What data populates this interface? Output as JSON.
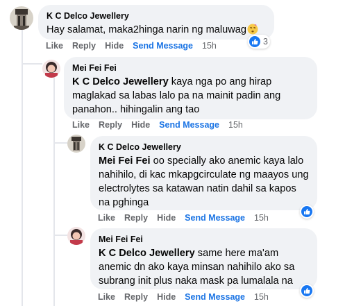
{
  "comments": [
    {
      "author": "K C Delco Jewellery",
      "mention": "",
      "text": "Hay salamat, maka2hinga narin ng maluwag",
      "emoji_icon": "face-with-spiral-eyes-icon",
      "time": "15h",
      "reaction_count": "3"
    },
    {
      "author": "Mei Fei Fei",
      "mention": "K C Delco Jewellery",
      "text": " kaya nga po ang hirap maglakad sa labas lalo pa na mainit padin ang panahon.. hihingalin ang tao",
      "time": "15h"
    },
    {
      "author": "K C Delco Jewellery",
      "mention": "Mei Fei Fei",
      "text": " oo specially ako anemic kaya lalo nahihilo, di kac mkapgcirculate ng maayos ung electrolytes sa katawan natin dahil sa kapos na pghinga",
      "time": "15h"
    },
    {
      "author": "Mei Fei Fei",
      "mention": "K C Delco Jewellery",
      "text": " same here ma'am anemic dn ako kaya minsan nahihilo ako sa subrang init plus naka mask pa lumalala na",
      "time": "15h"
    }
  ],
  "actions": {
    "like": "Like",
    "reply": "Reply",
    "hide": "Hide",
    "send_message": "Send Message"
  },
  "colors": {
    "bubble": "#f0f2f5",
    "link": "#1b74e4",
    "meta": "#65676b",
    "like_badge": "#1877f2"
  }
}
